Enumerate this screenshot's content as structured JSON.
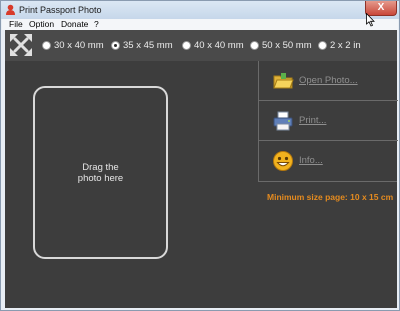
{
  "window": {
    "title": "Print Passport Photo",
    "close_symbol": "X"
  },
  "menu": [
    {
      "label": "File"
    },
    {
      "label": "Option"
    },
    {
      "label": "Donate"
    },
    {
      "label": "?"
    }
  ],
  "sizes": {
    "selected": "35 x 45 mm",
    "options": [
      {
        "label": "30 x 40 mm",
        "selected": false
      },
      {
        "label": "35 x 45 mm",
        "selected": true
      },
      {
        "label": "40 x 40 mm",
        "selected": false
      },
      {
        "label": "50 x 50 mm",
        "selected": false
      },
      {
        "label": "2 x 2 in",
        "selected": false
      }
    ]
  },
  "photo_area": {
    "hint_line1": "Drag the",
    "hint_line2": "photo here"
  },
  "actions": [
    {
      "label": "Open Photo...",
      "icon": "folder-icon"
    },
    {
      "label": "Print...",
      "icon": "printer-icon"
    },
    {
      "label": "Info...",
      "icon": "smiley-icon"
    }
  ],
  "notice": "Minimum size page: 10 x 15 cm",
  "colors": {
    "background": "#3d3d3d",
    "notice": "#e58b1f",
    "disabled_text": "#8f8f8f"
  }
}
